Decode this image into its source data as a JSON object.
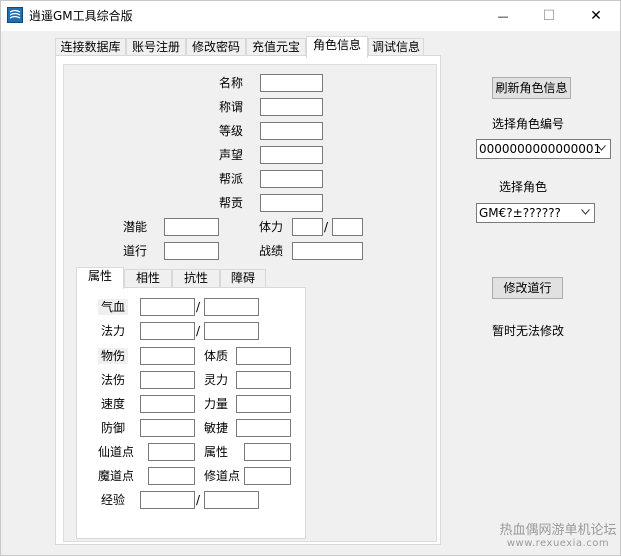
{
  "window": {
    "title": "逍遥GM工具综合版",
    "minimize_glyph": "—",
    "maximize_glyph": "☐",
    "close_glyph": "✕"
  },
  "tabs": [
    "连接数据库",
    "账号注册",
    "修改密码",
    "充值元宝",
    "角色信息",
    "调试信息"
  ],
  "active_tab": "角色信息",
  "role": {
    "name_label": "名称",
    "title_label": "称谓",
    "level_label": "等级",
    "fame_label": "声望",
    "faction_label": "帮派",
    "contribution_label": "帮贡",
    "potential_label": "潜能",
    "stamina_label": "体力",
    "dao_label": "道行",
    "merit_label": "战绩",
    "slash": "/"
  },
  "inner_tabs": [
    "属性",
    "相性",
    "抗性",
    "障碍"
  ],
  "attributes": {
    "hp_label": "气血",
    "mana_label": "法力",
    "phys_dmg_label": "物伤",
    "constitution_label": "体质",
    "magic_dmg_label": "法伤",
    "spirit_label": "灵力",
    "speed_label": "速度",
    "strength_label": "力量",
    "defense_label": "防御",
    "agility_label": "敏捷",
    "immortal_pts_label": "仙道点",
    "property_label": "属性",
    "demon_pts_label": "魔道点",
    "cultivation_pts_label": "修道点",
    "exp_label": "经验",
    "slash": "/"
  },
  "right": {
    "refresh_button": "刷新角色信息",
    "select_id_label": "选择角色编号",
    "role_id_value": "0000000000000001",
    "select_role_label": "选择角色",
    "role_value": "GM€?±??????",
    "modify_dao_button": "修改道行",
    "status_text": "暂时无法修改"
  },
  "watermark": {
    "line1": "热血偶网游单机论坛",
    "line2": "www.rexuexia.com"
  },
  "icons": {
    "app": "app-icon",
    "dropdown": "chevron-down-icon"
  }
}
